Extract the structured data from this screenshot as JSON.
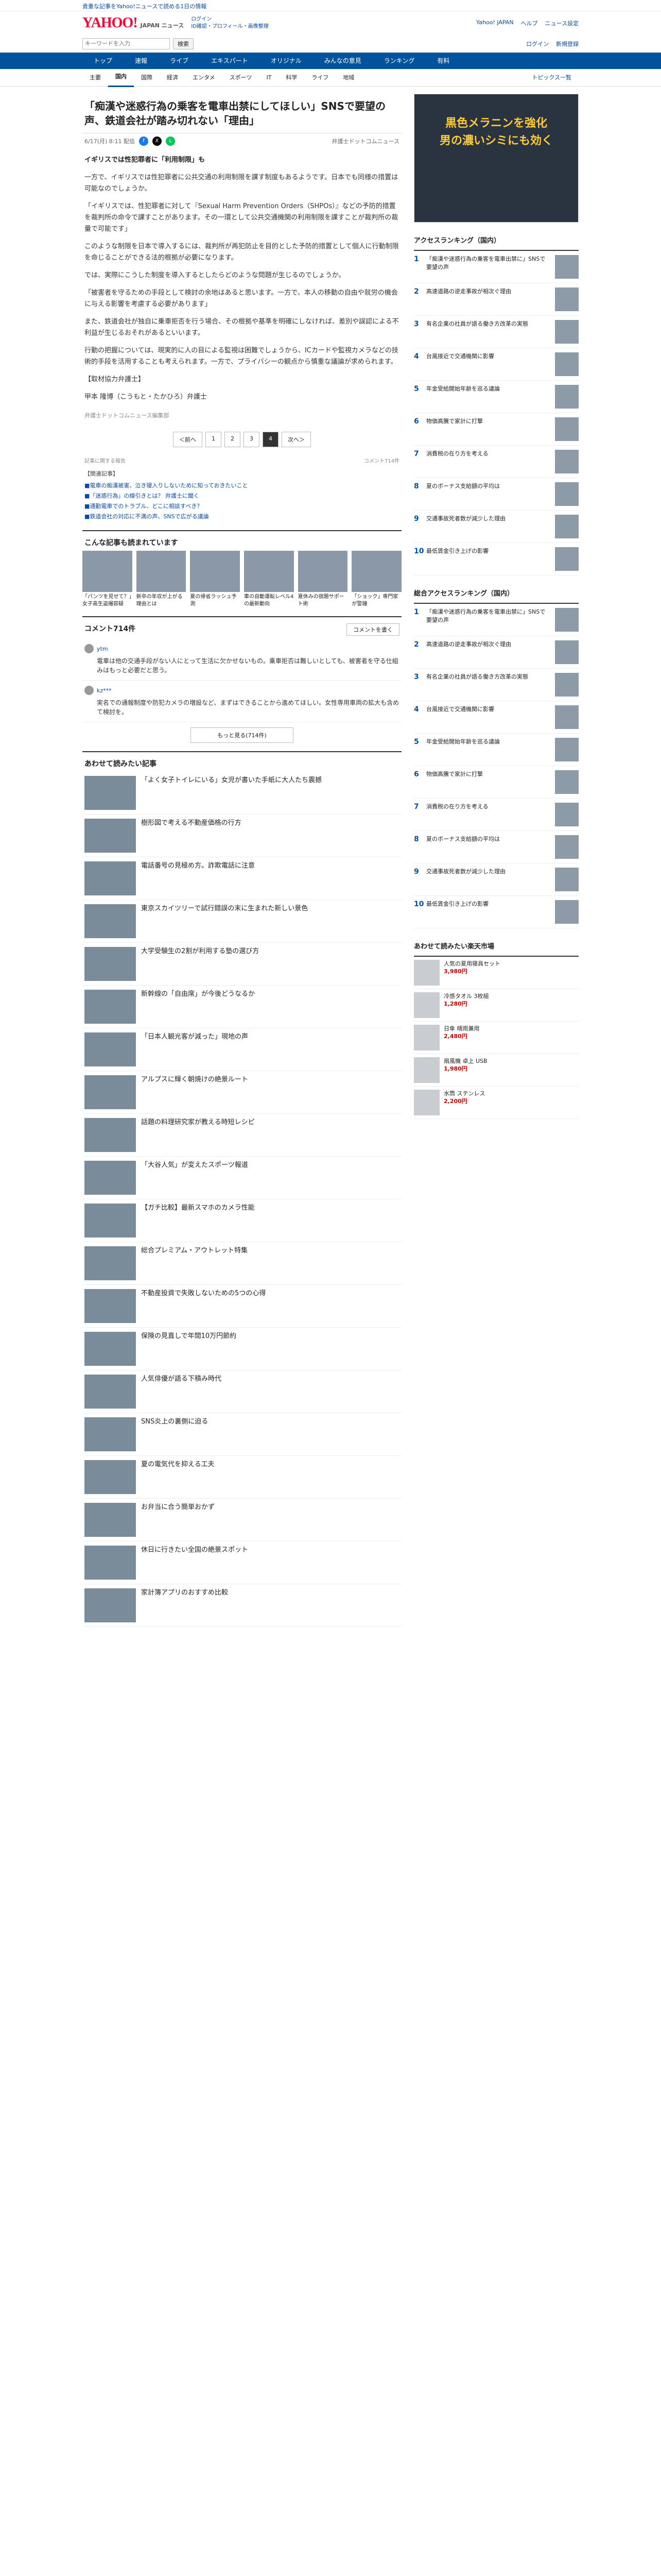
{
  "promo": "貴重な記事をYahoo!ニュースで読める1日の情報",
  "header": {
    "logo": "YAHOO!",
    "logo_sub": "JAPAN ニュース",
    "mid1": "ログイン",
    "mid2": "ID確認・プロフィール・画像整理",
    "links": [
      "Yahoo! JAPAN",
      "ヘルプ",
      "ニュース設定"
    ]
  },
  "search": {
    "placeholder": "キーワードを入力",
    "button": "検索",
    "links": [
      "ログイン",
      "新規登録"
    ]
  },
  "nav": [
    "トップ",
    "速報",
    "ライブ",
    "エキスパート",
    "オリジナル",
    "みんなの意見",
    "ランキング",
    "有料"
  ],
  "subnav": [
    "主要",
    "国内",
    "国際",
    "経済",
    "エンタメ",
    "スポーツ",
    "IT",
    "科学",
    "ライフ",
    "地域"
  ],
  "subnav_right": "トピックス一覧",
  "article": {
    "title": "「痴漢や迷惑行為の乗客を電車出禁にしてほしい」SNSで要望の声、鉄道会社が踏み切れない「理由」",
    "date": "6/17(月) 8:11 配信",
    "source": "弁護士ドットコムニュース",
    "lead": "イギリスでは性犯罪者に「利用制限」も",
    "paras": [
      "一方で、イギリスでは性犯罪者に公共交通の利用制限を課す制度もあるようです。日本でも同様の措置は可能なのでしょうか。",
      "「イギリスでは、性犯罪者に対して『Sexual Harm Prevention Orders（SHPOs）』などの予防的措置を裁判所の命令で課すことがあります。その一環として公共交通機関の利用制限を課すことが裁判所の裁量で可能です」",
      "このような制限を日本で導入するには、裁判所が再犯防止を目的とした予防的措置として個人に行動制限を命じることができる法的根拠が必要になります。",
      "では、実際にこうした制度を導入するとしたらどのような問題が生じるのでしょうか。",
      "「被害者を守るための手段として検討の余地はあると思います。一方で、本人の移動の自由や就労の機会に与える影響を考慮する必要があります」",
      "また、鉄道会社が独自に乗車拒否を行う場合、その根拠や基準を明確にしなければ、差別や誤認による不利益が生じるおそれがあるといいます。",
      "行動の把握については、現実的に人の目による監視は困難でしょうから、ICカードや監視カメラなどの技術的手段を活用することも考えられます。一方で、プライバシーの観点から慎重な議論が求められます。"
    ],
    "expert": "【取材協力弁護士】",
    "expert_body": "甲本 隆博（こうもと・たかひろ）弁護士",
    "footer": "弁護士ドットコムニュース編集部",
    "pages": [
      "＜前へ",
      "1",
      "2",
      "3",
      "4",
      "次へ＞"
    ],
    "tools": [
      "記事に関する報告",
      "コメント714件"
    ],
    "related_h": "【関連記事】",
    "related": [
      "■電車の痴漢被害、泣き寝入りしないために知っておきたいこと",
      "■「迷惑行為」の線引きとは？ 弁護士に聞く",
      "■通勤電車でのトラブル、どこに相談すべき？",
      "■鉄道会社の対応に不満の声、SNSで広がる議論"
    ]
  },
  "also": {
    "title": "こんな記事も読まれています",
    "items": [
      "「パンツを見せて？」女子高生盗撮容疑",
      "新卒の年収が上がる理由とは",
      "夏の帰省ラッシュ予測",
      "車の自動運転レベル4の最新動向",
      "夏休みの宿題サポート術",
      "「ショック」専門家が警鐘"
    ]
  },
  "comments": {
    "title": "コメント714件",
    "write": "コメントを書く",
    "items": [
      {
        "user": "ytm",
        "body": "電車は他の交通手段がない人にとって生活に欠かせないもの。乗車拒否は難しいとしても、被害者を守る仕組みはもっと必要だと思う。"
      },
      {
        "user": "kz***",
        "body": "実名での通報制度や防犯カメラの増設など、まずはできることから進めてほしい。女性専用車両の拡大も含めて検討を。"
      }
    ],
    "more": "もっと見る(714件)"
  },
  "feed": {
    "title": "あわせて読みたい記事",
    "items": [
      "「よく女子トイレにいる」女児が書いた手紙に大人たち震撼",
      "樹形図で考える不動産価格の行方",
      "電話番号の見極め方。詐欺電話に注意",
      "東京スカイツリーで試行錯誤の末に生まれた新しい景色",
      "大学受験生の2割が利用する塾の選び方",
      "新幹線の「自由席」が今後どうなるか",
      "「日本人観光客が減った」現地の声",
      "アルプスに輝く朝焼けの絶景ルート",
      "話題の料理研究家が教える時短レシピ",
      "「大谷人気」が変えたスポーツ報道",
      "【ガチ比較】最新スマホのカメラ性能",
      "総合プレミアム・アウトレット特集",
      "不動産投資で失敗しないための5つの心得",
      "保険の見直しで年間10万円節約",
      "人気俳優が語る下積み時代",
      "SNS炎上の裏側に迫る",
      "夏の電気代を抑える工夫",
      "お弁当に合う簡単おかず",
      "休日に行きたい全国の絶景スポット",
      "家計簿アプリのおすすめ比較"
    ]
  },
  "side": {
    "ad": {
      "line1": "黒色メラニンを強化",
      "line2": "男の濃いシミにも効く"
    },
    "ranking_title": "アクセスランキング（国内）",
    "ranking": [
      "「痴漢や迷惑行為の乗客を電車出禁に」SNSで要望の声",
      "高速道路の逆走事故が相次ぐ理由",
      "有名企業の社員が語る働き方改革の実態",
      "台風接近で交通機関に影響",
      "年金受給開始年齢を巡る議論",
      "物価高騰で家計に打撃",
      "消費税の在り方を考える",
      "夏のボーナス支給額の平均は",
      "交通事故死者数が減少した理由",
      "最低賃金引き上げの影響"
    ],
    "ranking2_title": "総合アクセスランキング（国内）",
    "shop_title": "あわせて読みたい楽天市場",
    "shop": [
      {
        "t": "人気の夏用寝具セット",
        "p": "3,980円"
      },
      {
        "t": "冷感タオル 3枚組",
        "p": "1,280円"
      },
      {
        "t": "日傘 晴雨兼用",
        "p": "2,480円"
      },
      {
        "t": "扇風機 卓上 USB",
        "p": "1,980円"
      },
      {
        "t": "水筒 ステンレス",
        "p": "2,200円"
      }
    ]
  }
}
